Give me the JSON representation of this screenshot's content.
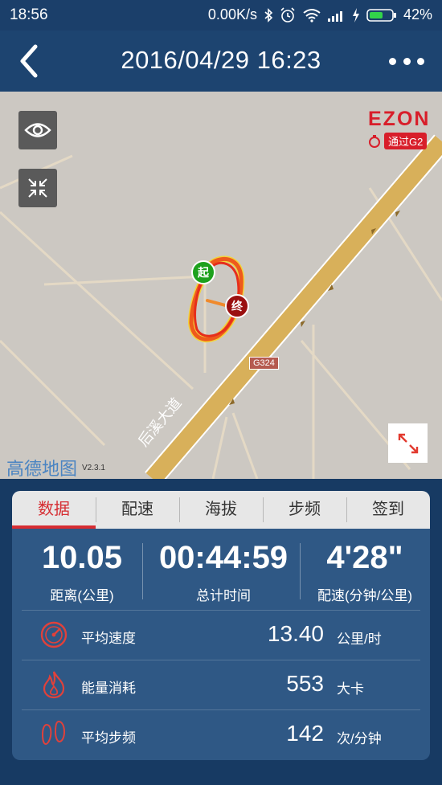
{
  "status_bar": {
    "time": "18:56",
    "network_speed": "0.00K/s",
    "battery": "42%"
  },
  "header": {
    "title": "2016/04/29 16:23"
  },
  "map": {
    "brand_name": "EZON",
    "brand_badge": "通过G2",
    "provider": "高德地图",
    "provider_version": "V2.3.1",
    "road_code": "G324",
    "road_name": "后溪大道",
    "start_marker": "起",
    "end_marker": "终"
  },
  "tabs": [
    {
      "label": "数据",
      "active": true
    },
    {
      "label": "配速",
      "active": false
    },
    {
      "label": "海拔",
      "active": false
    },
    {
      "label": "步频",
      "active": false
    },
    {
      "label": "签到",
      "active": false
    }
  ],
  "summary": {
    "distance": {
      "value": "10.05",
      "label": "距离(公里)"
    },
    "duration": {
      "value": "00:44:59",
      "label": "总计时间"
    },
    "pace": {
      "value": "4'28\"",
      "label": "配速(分钟/公里)"
    }
  },
  "stats": [
    {
      "icon": "speedometer-icon",
      "label": "平均速度",
      "value": "13.40",
      "unit": "公里/时"
    },
    {
      "icon": "flame-icon",
      "label": "能量消耗",
      "value": "553",
      "unit": "大卡"
    },
    {
      "icon": "footprints-icon",
      "label": "平均步频",
      "value": "142",
      "unit": "次/分钟"
    }
  ],
  "colors": {
    "accent": "#d62d32",
    "header": "#1d4470",
    "panel": "#2f5885",
    "map": "#ccc8c2"
  }
}
